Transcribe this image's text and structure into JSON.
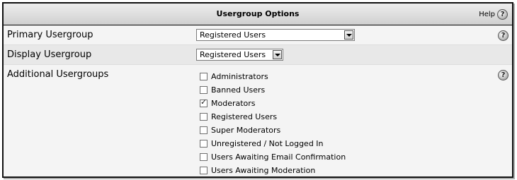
{
  "header": {
    "title": "Usergroup Options",
    "help_label": "Help"
  },
  "primary": {
    "label": "Primary Usergroup",
    "value": "Registered Users"
  },
  "display": {
    "label": "Display Usergroup",
    "value": "Registered Users"
  },
  "additional": {
    "label": "Additional Usergroups",
    "items": [
      {
        "label": "Administrators",
        "checked": false
      },
      {
        "label": "Banned Users",
        "checked": false
      },
      {
        "label": "Moderators",
        "checked": true
      },
      {
        "label": "Registered Users",
        "checked": false
      },
      {
        "label": "Super Moderators",
        "checked": false
      },
      {
        "label": "Unregistered / Not Logged In",
        "checked": false
      },
      {
        "label": "Users Awaiting Email Confirmation",
        "checked": false
      },
      {
        "label": "Users Awaiting Moderation",
        "checked": false
      }
    ]
  },
  "icons": {
    "help": "question-icon",
    "dropdown": "chevron-down-icon"
  }
}
